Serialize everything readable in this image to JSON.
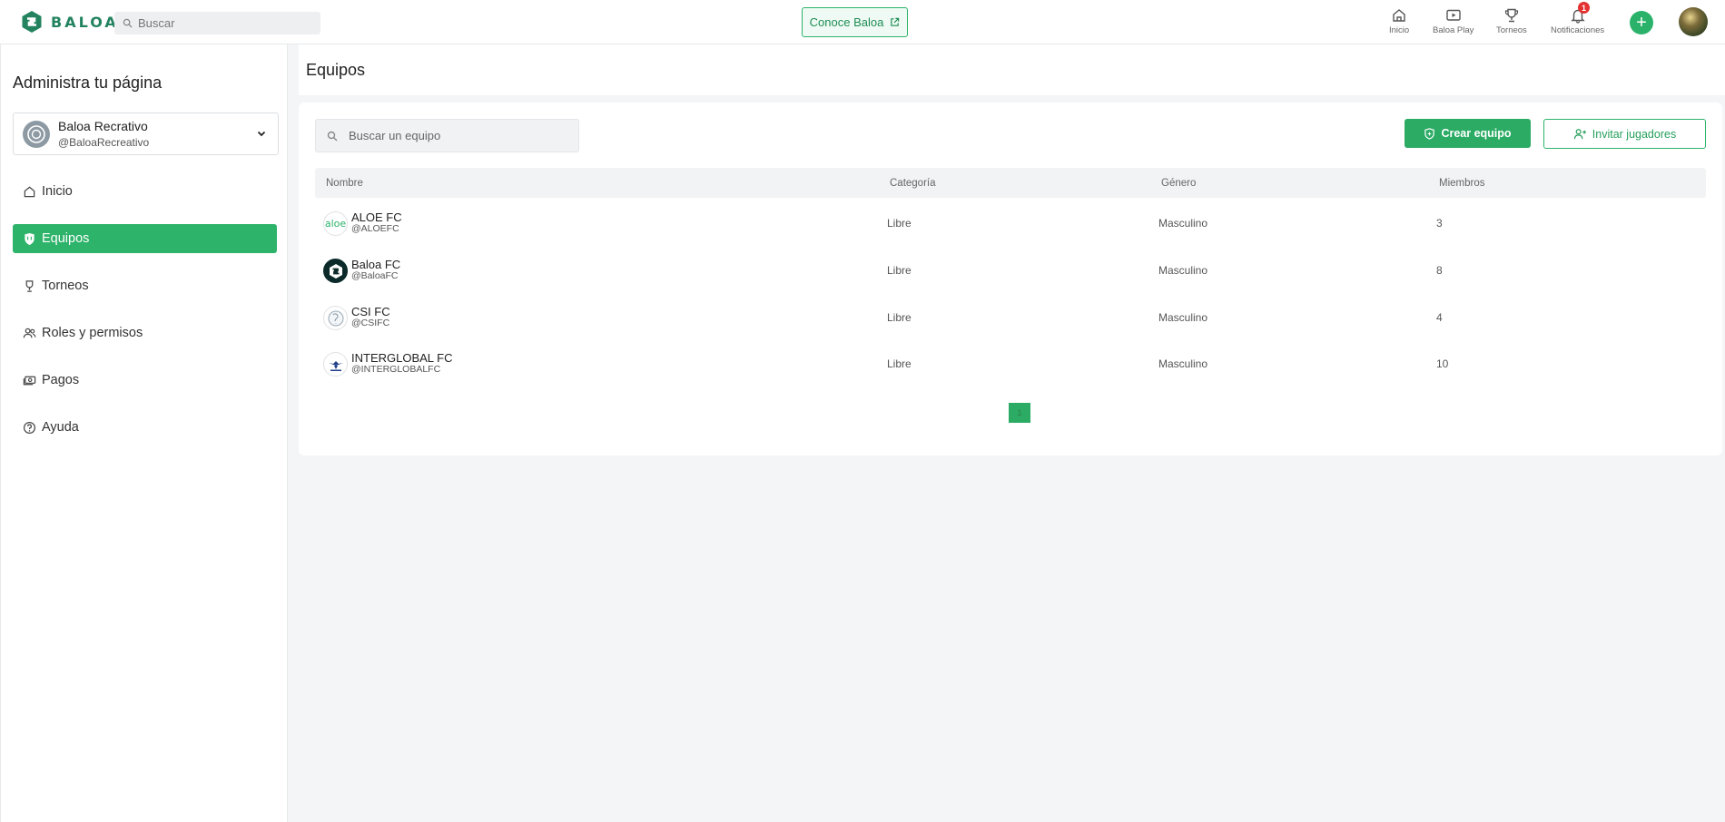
{
  "topbar": {
    "brand": "BALOA",
    "search_placeholder": "Buscar",
    "conoce_label": "Conoce Baloa",
    "nav": [
      {
        "label": "Inicio",
        "icon": "home-icon"
      },
      {
        "label": "Baloa Play",
        "icon": "play-icon"
      },
      {
        "label": "Torneos",
        "icon": "trophy-icon"
      },
      {
        "label": "Notificaciones",
        "icon": "bell-icon",
        "badge": "1"
      }
    ],
    "plus_label": "+"
  },
  "sidebar": {
    "title": "Administra tu página",
    "page": {
      "name": "Baloa Recrativo",
      "handle": "@BaloaRecreativo"
    },
    "items": [
      {
        "label": "Inicio",
        "icon": "home-icon"
      },
      {
        "label": "Equipos",
        "icon": "shield-icon",
        "active": true
      },
      {
        "label": "Torneos",
        "icon": "trophy-icon"
      },
      {
        "label": "Roles y permisos",
        "icon": "users-icon"
      },
      {
        "label": "Pagos",
        "icon": "cash-icon"
      },
      {
        "label": "Ayuda",
        "icon": "help-icon"
      }
    ]
  },
  "main": {
    "title": "Equipos",
    "search_placeholder": "Buscar un equipo",
    "crear_label": "Crear equipo",
    "invitar_label": "Invitar jugadores",
    "columns": [
      "Nombre",
      "Categoría",
      "Género",
      "Miembros"
    ],
    "teams": [
      {
        "name": "ALOE FC",
        "handle": "@ALOEFC",
        "category": "Libre",
        "gender": "Masculino",
        "members": "3",
        "logo_text": "aloe"
      },
      {
        "name": "Baloa FC",
        "handle": "@BaloaFC",
        "category": "Libre",
        "gender": "Masculino",
        "members": "8",
        "logo_text": ""
      },
      {
        "name": "CSI FC",
        "handle": "@CSIFC",
        "category": "Libre",
        "gender": "Masculino",
        "members": "4",
        "logo_text": ""
      },
      {
        "name": "INTERGLOBAL FC",
        "handle": "@INTERGLOBALFC",
        "category": "Libre",
        "gender": "Masculino",
        "members": "10",
        "logo_text": ""
      }
    ],
    "page_number": "1"
  },
  "colors": {
    "accent": "#2bab64",
    "brand": "#23835f",
    "badge": "#e33131"
  }
}
